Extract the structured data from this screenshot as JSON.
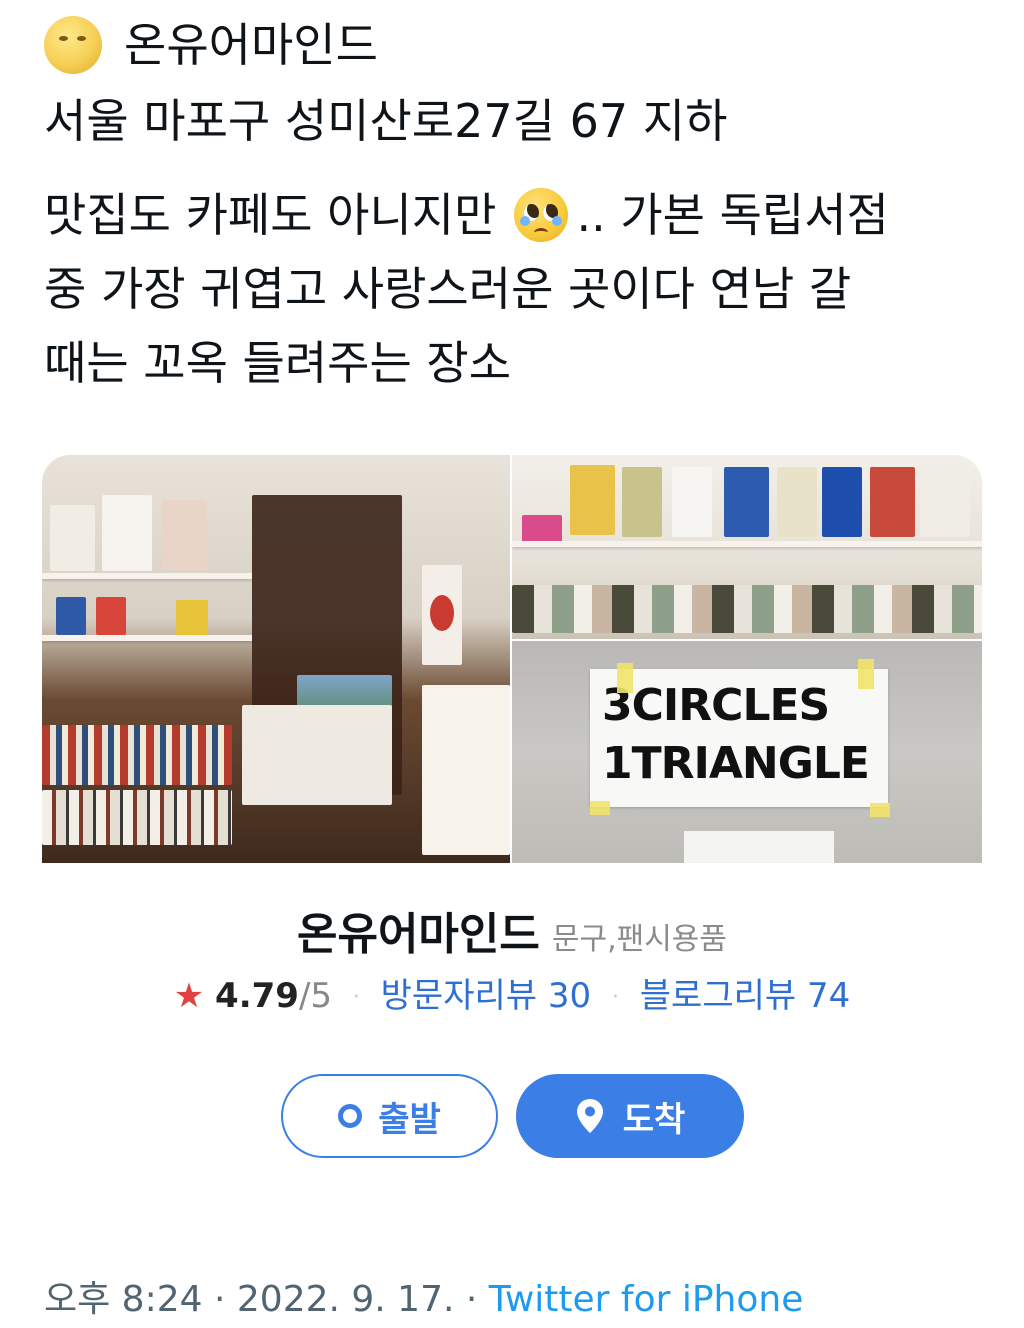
{
  "tweet": {
    "header_text": "온유어마인드",
    "address": "서울 마포구 성미산로27길 67 지하",
    "body_lines": [
      {
        "before_emoji": "맛집도 카페도 아니지만",
        "after_emoji": ".. 가본 독립서점"
      },
      {
        "text": "중 가장 귀엽고 사랑스러운 곳이다 연남 갈"
      },
      {
        "text": "때는 꼬옥 들려주는 장소"
      }
    ],
    "emojis": [
      "full-moon-face",
      "pleading-face"
    ]
  },
  "card": {
    "sign_text_line1": "3CIRCLES",
    "sign_text_line2": "1TRIANGLE",
    "place_name": "온유어마인드",
    "category": "문구,팬시용품",
    "rating_star": "★",
    "rating_value": "4.79",
    "rating_max": "/5",
    "visitor_reviews": "방문자리뷰 30",
    "blog_reviews": "블로그리뷰 74",
    "separator": "·",
    "depart_label": "출발",
    "arrive_label": "도착",
    "accent_color": "#3b7fe6"
  },
  "meta": {
    "time": "오후 8:24",
    "date": "2022. 9. 17.",
    "sep": "·",
    "source": "Twitter for iPhone"
  }
}
